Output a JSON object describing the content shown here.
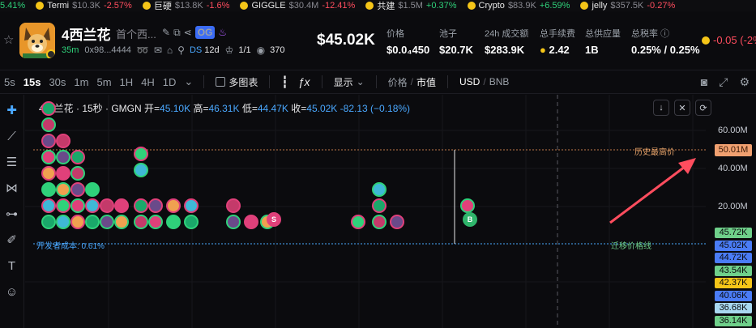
{
  "ticker": [
    {
      "name": "",
      "mc": "",
      "change": "5.41%",
      "dir": "up",
      "icon": "coin-icon",
      "color": "#ff4d5e"
    },
    {
      "name": "Termi",
      "mc": "$10.3K",
      "change": "-2.57%",
      "dir": "dn",
      "icon": "termi-token-icon",
      "color": "#f5c518"
    },
    {
      "name": "巨硬",
      "mc": "$13.8K",
      "change": "-1.6%",
      "dir": "dn",
      "icon": "jumbo-token-icon",
      "color": "#f5c518"
    },
    {
      "name": "GIGGLE",
      "mc": "$30.4M",
      "change": "-12.41%",
      "dir": "dn",
      "icon": "giggle-token-icon",
      "color": "#f5c518"
    },
    {
      "name": "共建",
      "mc": "$1.5M",
      "change": "+0.37%",
      "dir": "up",
      "icon": "gongjian-token-icon",
      "color": "#f5c518"
    },
    {
      "name": "Crypto",
      "mc": "$83.9K",
      "change": "+6.59%",
      "dir": "up",
      "icon": "crypto-token-icon",
      "color": "#f5c518"
    },
    {
      "name": "jelly",
      "mc": "$357.5K",
      "change": "-0.27%",
      "dir": "dn",
      "icon": "jelly-token-icon",
      "color": "#f5c518"
    }
  ],
  "token": {
    "name": "4西兰花",
    "subtitle": "首个西...",
    "badge": "OG",
    "age": "35m",
    "address": "0x98...4444",
    "ds_label": "DS",
    "ds_value": "12d",
    "holders_ratio": "1/1",
    "views": "370",
    "price_big": "$45.02K"
  },
  "stats": [
    {
      "label": "价格",
      "value": "$0.0₄450"
    },
    {
      "label": "池子",
      "value": "$20.7K"
    },
    {
      "label": "24h 成交额",
      "value": "$283.9K"
    },
    {
      "label": "总手续费",
      "value": "2.42"
    },
    {
      "label": "总供应量",
      "value": "1B"
    },
    {
      "label": "总税率",
      "value": "0.25% / 0.25%"
    }
  ],
  "change_pill": "-0.05 (-2%",
  "toolbar": {
    "timeframes": [
      "5s",
      "15s",
      "30s",
      "1m",
      "5m",
      "1H",
      "4H",
      "1D"
    ],
    "active_tf": "15s",
    "multi_chart": "多图表",
    "display": "显示",
    "price_label": "价格",
    "mcap_label": "市值",
    "quote": "USD",
    "quote_alt": "BNB"
  },
  "legend": {
    "title": "4西兰花 · 15秒 · GMGN",
    "open_k": "开=",
    "open_v": "45.10K",
    "high_k": "高=",
    "high_v": "46.31K",
    "low_k": "低=",
    "low_v": "44.47K",
    "close_k": "收=",
    "close_v": "45.02K",
    "chg": "-82.13 (−0.18%)"
  },
  "yaxis": [
    "60.00M",
    "40.00M",
    "20.00M"
  ],
  "ath_label": "历史最高价",
  "ath_value": "50.01M",
  "price_tags": [
    {
      "v": "45.72K",
      "bg": "#6fd08a"
    },
    {
      "v": "45.02K",
      "bg": "#4a7cf6"
    },
    {
      "v": "44.72K",
      "bg": "#4a7cf6"
    },
    {
      "v": "43.54K",
      "bg": "#6fd08a"
    },
    {
      "v": "42.37K",
      "bg": "#f5c518"
    },
    {
      "v": "40.06K",
      "bg": "#4a7cf6"
    },
    {
      "v": "36.68K",
      "bg": "#a8d8f0"
    },
    {
      "v": "36.14K",
      "bg": "#6fd08a"
    }
  ],
  "dev_label": "开发者成本: 0.61%",
  "mig_label": "迁移价格线",
  "colors": {
    "up": "#2fd17a",
    "down": "#ff4d5e",
    "accent": "#4aa8ff",
    "ath": "#f0a070"
  }
}
